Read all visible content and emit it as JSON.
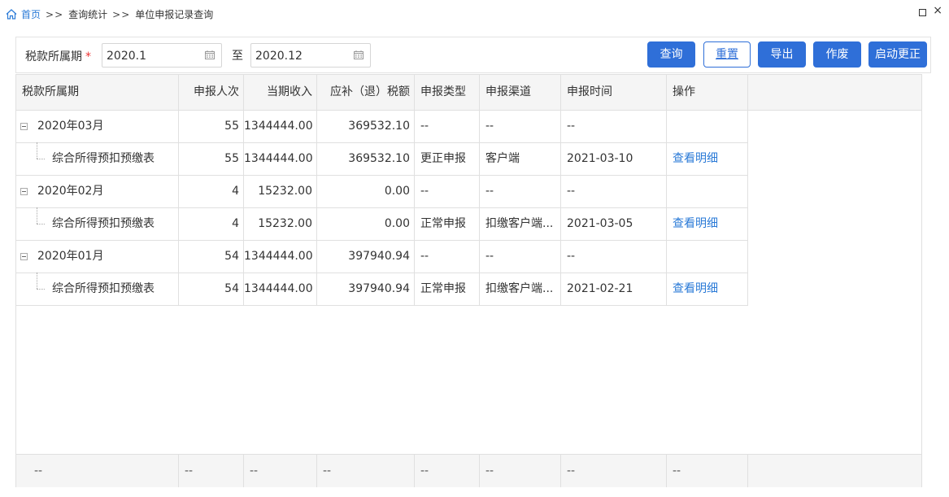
{
  "breadcrumb": {
    "home": "首页",
    "separator": ">>",
    "level1": "查询统计",
    "level2": "单位申报记录查询"
  },
  "window": {
    "restore_icon": "restore-icon",
    "close": "×"
  },
  "filter": {
    "label": "税款所属期",
    "required_mark": "*",
    "start_value": "2020.1",
    "to_label": "至",
    "end_value": "2020.12"
  },
  "buttons": {
    "query": "查询",
    "reset": "重置",
    "export": "导出",
    "void": "作废",
    "start_correction": "启动更正"
  },
  "colors": {
    "primary": "#2f6fd8",
    "link": "#2a7ad7",
    "header_bg": "#f5f5f5"
  },
  "table": {
    "headers": [
      "税款所属期",
      "申报人次",
      "当期收入",
      "应补（退）税额",
      "申报类型",
      "申报渠道",
      "申报时间",
      "操作"
    ],
    "rows": [
      {
        "period": "2020年03月",
        "count": "55",
        "income": "1344444.00",
        "tax": "369532.10",
        "type": "--",
        "channel": "--",
        "time": "--",
        "action": ""
      },
      {
        "period": "综合所得预扣预缴表",
        "count": "55",
        "income": "1344444.00",
        "tax": "369532.10",
        "type": "更正申报",
        "channel": "客户端",
        "time": "2021-03-10",
        "action": "查看明细"
      },
      {
        "period": "2020年02月",
        "count": "4",
        "income": "15232.00",
        "tax": "0.00",
        "type": "--",
        "channel": "--",
        "time": "--",
        "action": ""
      },
      {
        "period": "综合所得预扣预缴表",
        "count": "4",
        "income": "15232.00",
        "tax": "0.00",
        "type": "正常申报",
        "channel": "扣缴客户端...",
        "time": "2021-03-05",
        "action": "查看明细"
      },
      {
        "period": "2020年01月",
        "count": "54",
        "income": "1344444.00",
        "tax": "397940.94",
        "type": "--",
        "channel": "--",
        "time": "--",
        "action": ""
      },
      {
        "period": "综合所得预扣预缴表",
        "count": "54",
        "income": "1344444.00",
        "tax": "397940.94",
        "type": "正常申报",
        "channel": "扣缴客户端...",
        "time": "2021-02-21",
        "action": "查看明细"
      }
    ],
    "footer": [
      "--",
      "--",
      "--",
      "--",
      "--",
      "--",
      "--",
      "--"
    ]
  }
}
